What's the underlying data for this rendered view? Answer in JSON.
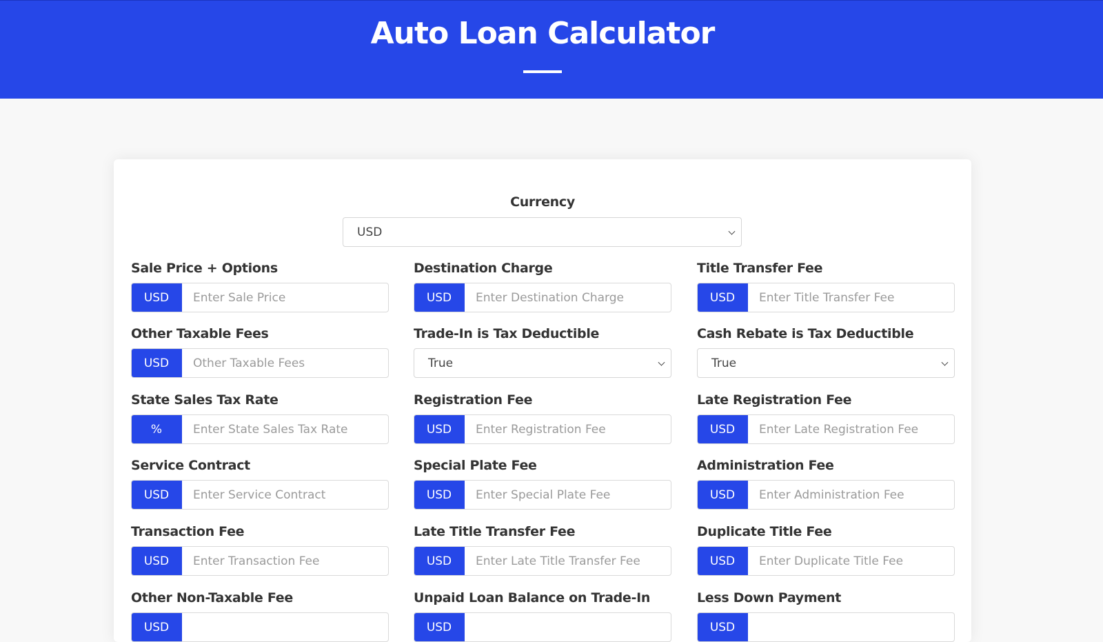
{
  "header": {
    "title": "Auto Loan Calculator"
  },
  "currency": {
    "label": "Currency",
    "selected": "USD"
  },
  "fields": [
    {
      "label": "Sale Price + Options",
      "type": "input",
      "addon": "USD",
      "placeholder": "Enter Sale Price"
    },
    {
      "label": "Destination Charge",
      "type": "input",
      "addon": "USD",
      "placeholder": "Enter Destination Charge"
    },
    {
      "label": "Title Transfer Fee",
      "type": "input",
      "addon": "USD",
      "placeholder": "Enter Title Transfer Fee"
    },
    {
      "label": "Other Taxable Fees",
      "type": "input",
      "addon": "USD",
      "placeholder": "Other Taxable Fees"
    },
    {
      "label": "Trade-In is Tax Deductible",
      "type": "select",
      "selected": "True"
    },
    {
      "label": "Cash Rebate is Tax Deductible",
      "type": "select",
      "selected": "True"
    },
    {
      "label": "State Sales Tax Rate",
      "type": "input",
      "addon": "%",
      "placeholder": "Enter State Sales Tax Rate"
    },
    {
      "label": "Registration Fee",
      "type": "input",
      "addon": "USD",
      "placeholder": "Enter Registration Fee"
    },
    {
      "label": "Late Registration Fee",
      "type": "input",
      "addon": "USD",
      "placeholder": "Enter Late Registration Fee"
    },
    {
      "label": "Service Contract",
      "type": "input",
      "addon": "USD",
      "placeholder": "Enter Service Contract"
    },
    {
      "label": "Special Plate Fee",
      "type": "input",
      "addon": "USD",
      "placeholder": "Enter Special Plate Fee"
    },
    {
      "label": "Administration Fee",
      "type": "input",
      "addon": "USD",
      "placeholder": "Enter Administration Fee"
    },
    {
      "label": "Transaction Fee",
      "type": "input",
      "addon": "USD",
      "placeholder": "Enter Transaction Fee"
    },
    {
      "label": "Late Title Transfer Fee",
      "type": "input",
      "addon": "USD",
      "placeholder": "Enter Late Title Transfer Fee"
    },
    {
      "label": "Duplicate Title Fee",
      "type": "input",
      "addon": "USD",
      "placeholder": "Enter Duplicate Title Fee"
    },
    {
      "label": "Other Non-Taxable Fee",
      "type": "input",
      "addon": "USD",
      "placeholder": ""
    },
    {
      "label": "Unpaid Loan Balance on Trade-In",
      "type": "input",
      "addon": "USD",
      "placeholder": ""
    },
    {
      "label": "Less Down Payment",
      "type": "input",
      "addon": "USD",
      "placeholder": ""
    }
  ],
  "colors": {
    "brand": "#2647e8",
    "background": "#f8f8f8",
    "card": "#ffffff",
    "label_text": "#333333",
    "placeholder_text": "#9a9a9a"
  }
}
